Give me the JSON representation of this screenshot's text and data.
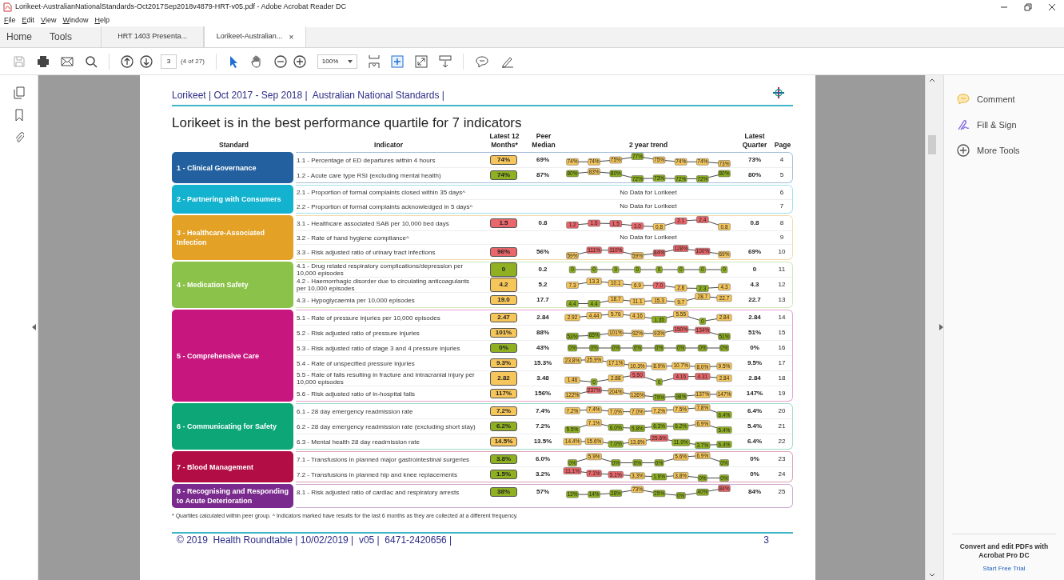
{
  "window": {
    "title": "Lorikeet-AustralianNationalStandards-Oct2017Sep2018v4879-HRT-v05.pdf - Adobe Acrobat Reader DC"
  },
  "menu": [
    "File",
    "Edit",
    "View",
    "Window",
    "Help"
  ],
  "nav_tabs": [
    {
      "label": "Home",
      "selected": false
    },
    {
      "label": "Tools",
      "selected": false
    }
  ],
  "doc_tabs": [
    {
      "label": "HRT 1403 Presenta...",
      "selected": false
    },
    {
      "label": "Lorikeet-Australian...",
      "selected": true,
      "close": "×"
    }
  ],
  "toolbar": {
    "page_field": "3",
    "page_count": "(4 of 27)",
    "zoom": "100%"
  },
  "document": {
    "header": "Lorikeet | Oct 2017 - Sep 2018 |  Australian National Standards |",
    "title": "Lorikeet is in the best performance quartile for 7 indicators",
    "columns": [
      "Standard",
      "Indicator",
      "Latest 12 Months*",
      "Peer Median",
      "2 year trend",
      "Latest Quarter",
      "Page"
    ],
    "groups": [
      {
        "name": "1 - Clinical Governance",
        "color": "#22609f",
        "rows": [
          {
            "indicator": "1.1 - Percentage of ED departures within 4 hours",
            "latest": {
              "text": "74%",
              "color": "#f6c65b"
            },
            "peer": "69%",
            "trend": [
              {
                "text": "74%",
                "color": "#f6c65b"
              },
              {
                "text": "74%",
                "color": "#f6c65b"
              },
              {
                "text": "75%",
                "color": "#f6c65b"
              },
              {
                "text": "77%",
                "color": "#8fb021"
              },
              {
                "text": "75%",
                "color": "#f6c65b"
              },
              {
                "text": "74%",
                "color": "#f6c65b"
              },
              {
                "text": "74%",
                "color": "#f6c65b"
              },
              {
                "text": "73%",
                "color": "#f6c65b"
              }
            ],
            "latest_quarter": "73%",
            "page": "4"
          },
          {
            "indicator": "1.2 - Acute care type RSI (excluding mental health)",
            "latest": {
              "text": "74%",
              "color": "#8fb021"
            },
            "peer": "87%",
            "trend": [
              {
                "text": "80%",
                "color": "#8fb021"
              },
              {
                "text": "83%",
                "color": "#f6c65b"
              },
              {
                "text": "80%",
                "color": "#8fb021"
              },
              {
                "text": "72%",
                "color": "#8fb021"
              },
              {
                "text": "73%",
                "color": "#8fb021"
              },
              {
                "text": "72%",
                "color": "#8fb021"
              },
              {
                "text": "72%",
                "color": "#8fb021"
              },
              {
                "text": "80%",
                "color": "#8fb021"
              }
            ],
            "latest_quarter": "80%",
            "page": "5"
          }
        ]
      },
      {
        "name": "2 - Partnering with Consumers",
        "color": "#13b3cf",
        "rows": [
          {
            "indicator": "2.1 - Proportion of formal complaints closed within 35 days^",
            "no_data": "No Data for Lorikeet",
            "page": "6"
          },
          {
            "indicator": "2.2 - Proportion of formal complaints acknowledged in 5 days^",
            "no_data": "No Data for Lorikeet",
            "page": "7"
          }
        ]
      },
      {
        "name": "3 - Healthcare-Associated Infection",
        "color": "#e3a126",
        "rows": [
          {
            "indicator": "3.1 - Healthcare associated SAB per 10,000 bed days",
            "latest": {
              "text": "1.5",
              "color": "#e9666a"
            },
            "peer": "0.8",
            "trend": [
              {
                "text": "1.2",
                "color": "#e9666a"
              },
              {
                "text": "1.6",
                "color": "#e9666a"
              },
              {
                "text": "1.5",
                "color": "#e9666a"
              },
              {
                "text": "1.0",
                "color": "#e9666a"
              },
              {
                "text": "0.8",
                "color": "#f6c65b"
              },
              {
                "text": "2.1",
                "color": "#e9666a"
              },
              {
                "text": "2.4",
                "color": "#e9666a"
              },
              {
                "text": "0.8",
                "color": "#f6c65b"
              }
            ],
            "latest_quarter": "0.8",
            "page": "8"
          },
          {
            "indicator": "3.2 - Rate of hand hygiene compliance^",
            "no_data": "No Data for Lorikeet",
            "page": "9"
          },
          {
            "indicator": "3.3 - Risk adjusted ratio of urinary tract infections",
            "latest": {
              "text": "96%",
              "color": "#e9666a"
            },
            "peer": "56%",
            "trend": [
              {
                "text": "59%",
                "color": "#f6c65b"
              },
              {
                "text": "111%",
                "color": "#e9666a"
              },
              {
                "text": "110%",
                "color": "#e9666a"
              },
              {
                "text": "59%",
                "color": "#f6c65b"
              },
              {
                "text": "84%",
                "color": "#e9666a"
              },
              {
                "text": "128%",
                "color": "#e9666a"
              },
              {
                "text": "100%",
                "color": "#e9666a"
              },
              {
                "text": "69%",
                "color": "#f6c65b"
              }
            ],
            "latest_quarter": "69%",
            "page": "10"
          }
        ]
      },
      {
        "name": "4 - Medication Safety",
        "color": "#8bc34a",
        "rows": [
          {
            "indicator": "4.1 - Drug related respiratory complications/depression per 10,000 episodes",
            "latest": {
              "text": "0",
              "color": "#8fb021"
            },
            "peer": "0.2",
            "trend": [
              {
                "text": "0",
                "color": "#8fb021"
              },
              {
                "text": "0",
                "color": "#8fb021"
              },
              {
                "text": "0",
                "color": "#8fb021"
              },
              {
                "text": "0",
                "color": "#8fb021"
              },
              {
                "text": "0",
                "color": "#8fb021"
              },
              {
                "text": "0",
                "color": "#8fb021"
              },
              {
                "text": "0",
                "color": "#8fb021"
              },
              {
                "text": "0",
                "color": "#8fb021"
              }
            ],
            "latest_quarter": "0",
            "page": "11"
          },
          {
            "indicator": "4.2 - Haemorrhagic disorder due to circulating anticoagulants per 10,000 episodes",
            "latest": {
              "text": "4.2",
              "color": "#f6c65b"
            },
            "peer": "5.2",
            "trend": [
              {
                "text": "7.3",
                "color": "#f6c65b"
              },
              {
                "text": "13.3",
                "color": "#f6c65b"
              },
              {
                "text": "10.1",
                "color": "#f6c65b"
              },
              {
                "text": "6.9",
                "color": "#f6c65b"
              },
              {
                "text": "7.0",
                "color": "#e9666a"
              },
              {
                "text": "2.8",
                "color": "#f6c65b"
              },
              {
                "text": "2.3",
                "color": "#8fb021"
              },
              {
                "text": "4.3",
                "color": "#f6c65b"
              }
            ],
            "latest_quarter": "4.3",
            "page": "12"
          },
          {
            "indicator": "4.3 - Hypoglycaemia per 10,000 episodes",
            "latest": {
              "text": "19.0",
              "color": "#f6c65b"
            },
            "peer": "17.7",
            "trend": [
              {
                "text": "4.4",
                "color": "#8fb021"
              },
              {
                "text": "4.4",
                "color": "#8fb021"
              },
              {
                "text": "18.7",
                "color": "#f6c65b"
              },
              {
                "text": "11.1",
                "color": "#f6c65b"
              },
              {
                "text": "15.3",
                "color": "#f6c65b"
              },
              {
                "text": "9.7",
                "color": "#f6c65b"
              },
              {
                "text": "28.7",
                "color": "#f6c65b"
              },
              {
                "text": "22.7",
                "color": "#f6c65b"
              }
            ],
            "latest_quarter": "22.7",
            "page": "13"
          }
        ]
      },
      {
        "name": "5 - Comprehensive Care",
        "color": "#c8167f",
        "rows": [
          {
            "indicator": "5.1 - Rate of pressure injuries per 10,000 episodes",
            "latest": {
              "text": "2.47",
              "color": "#f6c65b"
            },
            "peer": "2.84",
            "trend": [
              {
                "text": "2.92",
                "color": "#f6c65b"
              },
              {
                "text": "4.44",
                "color": "#f6c65b"
              },
              {
                "text": "5.76",
                "color": "#f6c65b"
              },
              {
                "text": "4.16",
                "color": "#f6c65b"
              },
              {
                "text": "1.35",
                "color": "#8fb021"
              },
              {
                "text": "5.55",
                "color": "#f6c65b"
              },
              {
                "text": "0",
                "color": "#8fb021"
              },
              {
                "text": "2.84",
                "color": "#f6c65b"
              }
            ],
            "latest_quarter": "2.84",
            "page": "14"
          },
          {
            "indicator": "5.2 - Risk adjusted ratio of pressure injuries",
            "latest": {
              "text": "101%",
              "color": "#f6c65b"
            },
            "peer": "88%",
            "trend": [
              {
                "text": "53%",
                "color": "#8fb021"
              },
              {
                "text": "65%",
                "color": "#8fb021"
              },
              {
                "text": "101%",
                "color": "#f6c65b"
              },
              {
                "text": "92%",
                "color": "#f6c65b"
              },
              {
                "text": "93%",
                "color": "#f6c65b"
              },
              {
                "text": "150%",
                "color": "#e9666a"
              },
              {
                "text": "134%",
                "color": "#e9666a"
              },
              {
                "text": "51%",
                "color": "#8fb021"
              }
            ],
            "latest_quarter": "51%",
            "page": "15"
          },
          {
            "indicator": "5.3 - Risk adjusted ratio of stage 3 and 4 pressure injuries",
            "latest": {
              "text": "0%",
              "color": "#8fb021"
            },
            "peer": "43%",
            "trend": [
              {
                "text": "0%",
                "color": "#8fb021"
              },
              {
                "text": "0%",
                "color": "#8fb021"
              },
              {
                "text": "0%",
                "color": "#8fb021"
              },
              {
                "text": "0%",
                "color": "#8fb021"
              },
              {
                "text": "0%",
                "color": "#8fb021"
              },
              {
                "text": "0%",
                "color": "#8fb021"
              },
              {
                "text": "0%",
                "color": "#8fb021"
              },
              {
                "text": "0%",
                "color": "#8fb021"
              }
            ],
            "latest_quarter": "0%",
            "page": "16"
          },
          {
            "indicator": "5.4 - Rate of unspecified pressure injuries",
            "latest": {
              "text": "9.3%",
              "color": "#f6c65b"
            },
            "peer": "15.3%",
            "trend": [
              {
                "text": "23.8%",
                "color": "#f6c65b"
              },
              {
                "text": "25.9%",
                "color": "#f6c65b"
              },
              {
                "text": "17.1%",
                "color": "#f6c65b"
              },
              {
                "text": "10.3%",
                "color": "#f6c65b"
              },
              {
                "text": "8.9%",
                "color": "#f6c65b"
              },
              {
                "text": "10.7%",
                "color": "#f6c65b"
              },
              {
                "text": "8.0%",
                "color": "#f6c65b"
              },
              {
                "text": "9.5%",
                "color": "#f6c65b"
              }
            ],
            "latest_quarter": "9.5%",
            "page": "17"
          },
          {
            "indicator": "5.5 - Rate of falls resulting in fracture and intracranial injury per 10,000 episodes",
            "latest": {
              "text": "2.82",
              "color": "#f6c65b"
            },
            "peer": "3.48",
            "trend": [
              {
                "text": "1.46",
                "color": "#f6c65b"
              },
              {
                "text": "0",
                "color": "#8fb021"
              },
              {
                "text": "2.88",
                "color": "#f6c65b"
              },
              {
                "text": "5.50",
                "color": "#e9666a"
              },
              {
                "text": "0",
                "color": "#8fb021"
              },
              {
                "text": "4.16",
                "color": "#e9666a"
              },
              {
                "text": "4.31",
                "color": "#e9666a"
              },
              {
                "text": "2.84",
                "color": "#f6c65b"
              }
            ],
            "latest_quarter": "2.84",
            "page": "18"
          },
          {
            "indicator": "5.6 - Risk adjusted ratio of in-hospital falls",
            "latest": {
              "text": "117%",
              "color": "#f6c65b"
            },
            "peer": "156%",
            "trend": [
              {
                "text": "122%",
                "color": "#f6c65b"
              },
              {
                "text": "237%",
                "color": "#e9666a"
              },
              {
                "text": "204%",
                "color": "#f6c65b"
              },
              {
                "text": "126%",
                "color": "#f6c65b"
              },
              {
                "text": "79%",
                "color": "#8fb021"
              },
              {
                "text": "98%",
                "color": "#8fb021"
              },
              {
                "text": "137%",
                "color": "#f6c65b"
              },
              {
                "text": "147%",
                "color": "#f6c65b"
              }
            ],
            "latest_quarter": "147%",
            "page": "19"
          }
        ]
      },
      {
        "name": "6 - Communicating for Safety",
        "color": "#0ca677",
        "rows": [
          {
            "indicator": "6.1 - 28 day emergency readmission rate",
            "latest": {
              "text": "7.2%",
              "color": "#f6c65b"
            },
            "peer": "7.4%",
            "trend": [
              {
                "text": "7.2%",
                "color": "#f6c65b"
              },
              {
                "text": "7.4%",
                "color": "#f6c65b"
              },
              {
                "text": "7.0%",
                "color": "#f6c65b"
              },
              {
                "text": "7.0%",
                "color": "#f6c65b"
              },
              {
                "text": "7.2%",
                "color": "#f6c65b"
              },
              {
                "text": "7.5%",
                "color": "#f6c65b"
              },
              {
                "text": "7.8%",
                "color": "#f6c65b"
              },
              {
                "text": "6.4%",
                "color": "#8fb021"
              }
            ],
            "latest_quarter": "6.4%",
            "page": "20"
          },
          {
            "indicator": "6.2 - 28 day emergency readmission rate (excluding short stay)",
            "latest": {
              "text": "6.2%",
              "color": "#8fb021"
            },
            "peer": "7.2%",
            "trend": [
              {
                "text": "5.5%",
                "color": "#8fb021"
              },
              {
                "text": "7.1%",
                "color": "#f6c65b"
              },
              {
                "text": "6.0%",
                "color": "#8fb021"
              },
              {
                "text": "5.8%",
                "color": "#8fb021"
              },
              {
                "text": "6.3%",
                "color": "#8fb021"
              },
              {
                "text": "6.2%",
                "color": "#8fb021"
              },
              {
                "text": "6.9%",
                "color": "#f6c65b"
              },
              {
                "text": "5.4%",
                "color": "#8fb021"
              }
            ],
            "latest_quarter": "5.4%",
            "page": "21"
          },
          {
            "indicator": "6.3 - Mental health 28 day readmission rate",
            "latest": {
              "text": "14.5%",
              "color": "#f6c65b"
            },
            "peer": "13.5%",
            "trend": [
              {
                "text": "14.4%",
                "color": "#f6c65b"
              },
              {
                "text": "15.6%",
                "color": "#f6c65b"
              },
              {
                "text": "7.0%",
                "color": "#8fb021"
              },
              {
                "text": "13.8%",
                "color": "#f6c65b"
              },
              {
                "text": "25.6%",
                "color": "#e9666a"
              },
              {
                "text": "11.9%",
                "color": "#8fb021"
              },
              {
                "text": "3.7%",
                "color": "#8fb021"
              },
              {
                "text": "6.4%",
                "color": "#8fb021"
              }
            ],
            "latest_quarter": "6.4%",
            "page": "22"
          }
        ]
      },
      {
        "name": "7 - Blood Management",
        "color": "#b20d45",
        "rows": [
          {
            "indicator": "7.1 - Transfusions in planned major gastrointestinal surgeries",
            "latest": {
              "text": "3.8%",
              "color": "#8fb021"
            },
            "peer": "6.0%",
            "trend": [
              {
                "text": "0%",
                "color": "#8fb021"
              },
              {
                "text": "5.9%",
                "color": "#f6c65b"
              },
              {
                "text": "0%",
                "color": "#8fb021"
              },
              {
                "text": "0%",
                "color": "#8fb021"
              },
              {
                "text": "0%",
                "color": "#8fb021"
              },
              {
                "text": "5.6%",
                "color": "#f6c65b"
              },
              {
                "text": "6.9%",
                "color": "#f6c65b"
              },
              {
                "text": "0%",
                "color": "#8fb021"
              }
            ],
            "latest_quarter": "0%",
            "page": "23"
          },
          {
            "indicator": "7.2 - Transfusions in planned hip and knee replacements",
            "latest": {
              "text": "1.5%",
              "color": "#8fb021"
            },
            "peer": "3.2%",
            "trend": [
              {
                "text": "11.1%",
                "color": "#e9666a"
              },
              {
                "text": "7.1%",
                "color": "#e9666a"
              },
              {
                "text": "5.1%",
                "color": "#e9666a"
              },
              {
                "text": "3.3%",
                "color": "#f6c65b"
              },
              {
                "text": "1.9%",
                "color": "#8fb021"
              },
              {
                "text": "3.8%",
                "color": "#f6c65b"
              },
              {
                "text": "0%",
                "color": "#8fb021"
              },
              {
                "text": "0%",
                "color": "#8fb021"
              }
            ],
            "latest_quarter": "0%",
            "page": "24"
          }
        ]
      },
      {
        "name": "8 - Recognising and Responding to Acute Deterioration",
        "color": "#7a2a8d",
        "rows": [
          {
            "indicator": "8.1 - Risk adjusted ratio of cardiac and respiratory arrests",
            "latest": {
              "text": "38%",
              "color": "#8fb021"
            },
            "peer": "57%",
            "trend": [
              {
                "text": "13%",
                "color": "#8fb021"
              },
              {
                "text": "14%",
                "color": "#8fb021"
              },
              {
                "text": "28%",
                "color": "#8fb021"
              },
              {
                "text": "73%",
                "color": "#f6c65b"
              },
              {
                "text": "25%",
                "color": "#8fb021"
              },
              {
                "text": "0%",
                "color": "#8fb021"
              },
              {
                "text": "40%",
                "color": "#8fb021"
              },
              {
                "text": "84%",
                "color": "#e9666a"
              }
            ],
            "latest_quarter": "84%",
            "page": "25"
          }
        ]
      }
    ],
    "footnote": "* Quartiles calculated within peer group. ^ Indicators marked have results for the last 6 months as they are collected at a different frequency.",
    "footer": "© 2019  Health Roundtable | 10/02/2019 |  v05 |  6471-2420656 |",
    "page_number": "3"
  },
  "right_panel": {
    "tools": [
      {
        "kind": "comment",
        "label": "Comment"
      },
      {
        "kind": "sign",
        "label": "Fill & Sign"
      },
      {
        "kind": "more",
        "label": "More Tools"
      }
    ],
    "promo": "Convert and edit PDFs with Acrobat Pro DC",
    "link": "Start Free Trial"
  }
}
